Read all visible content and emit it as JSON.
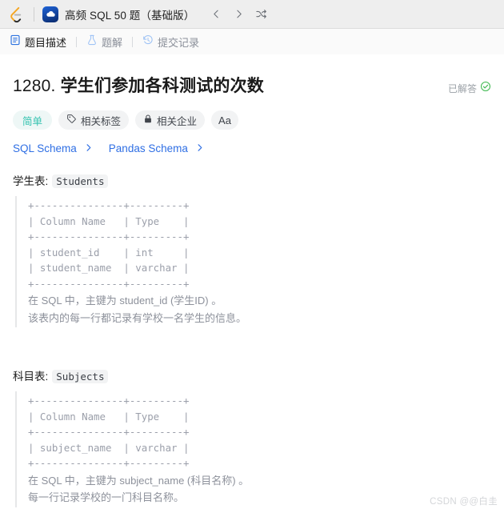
{
  "header": {
    "logo_icon": "leetcode-logo-icon",
    "study_plan_icon": "cloud-study-plan-icon",
    "study_plan_title": "高频 SQL 50 题（基础版）",
    "prev_icon": "chevron-left-icon",
    "next_icon": "chevron-right-icon",
    "shuffle_icon": "shuffle-icon"
  },
  "tabs": [
    {
      "label": "题目描述",
      "icon": "description-icon",
      "active": true
    },
    {
      "label": "题解",
      "icon": "flask-icon",
      "active": false
    },
    {
      "label": "提交记录",
      "icon": "history-icon",
      "active": false
    }
  ],
  "question": {
    "number": "1280.",
    "title": "学生们参加各科测试的次数",
    "status_label": "已解答",
    "status_icon": "check-circle-icon",
    "status_color": "#3fb950"
  },
  "tags": [
    {
      "label": "简单",
      "icon": null,
      "accent": "#35c3b0"
    },
    {
      "label": "相关标签",
      "icon": "tag-icon",
      "accent": "#41454c"
    },
    {
      "label": "相关企业",
      "icon": "lock-icon",
      "accent": "#41454c"
    },
    {
      "label": "Aa",
      "icon": "translate-icon",
      "accent": "#3c4047"
    }
  ],
  "schema_links": [
    {
      "label": "SQL Schema",
      "icon": "chevron-right-icon"
    },
    {
      "label": "Pandas Schema",
      "icon": "chevron-right-icon"
    }
  ],
  "sections": [
    {
      "heading": "学生表:",
      "table_name": "Students",
      "ascii": "+---------------+---------+\n| Column Name   | Type    |\n+---------------+---------+\n| student_id    | int     |\n| student_name  | varchar |\n+---------------+---------+",
      "notes": [
        "在 SQL 中，主键为 student_id (学生ID) 。",
        "该表内的每一行都记录有学校一名学生的信息。"
      ]
    },
    {
      "heading": "科目表:",
      "table_name": "Subjects",
      "ascii": "+---------------+---------+\n| Column Name   | Type    |\n+---------------+---------+\n| subject_name  | varchar |\n+---------------+---------+",
      "notes": [
        "在 SQL 中，主键为 subject_name (科目名称) 。",
        "每一行记录学校的一门科目名称。"
      ]
    }
  ],
  "watermark": "CSDN @@白圭"
}
